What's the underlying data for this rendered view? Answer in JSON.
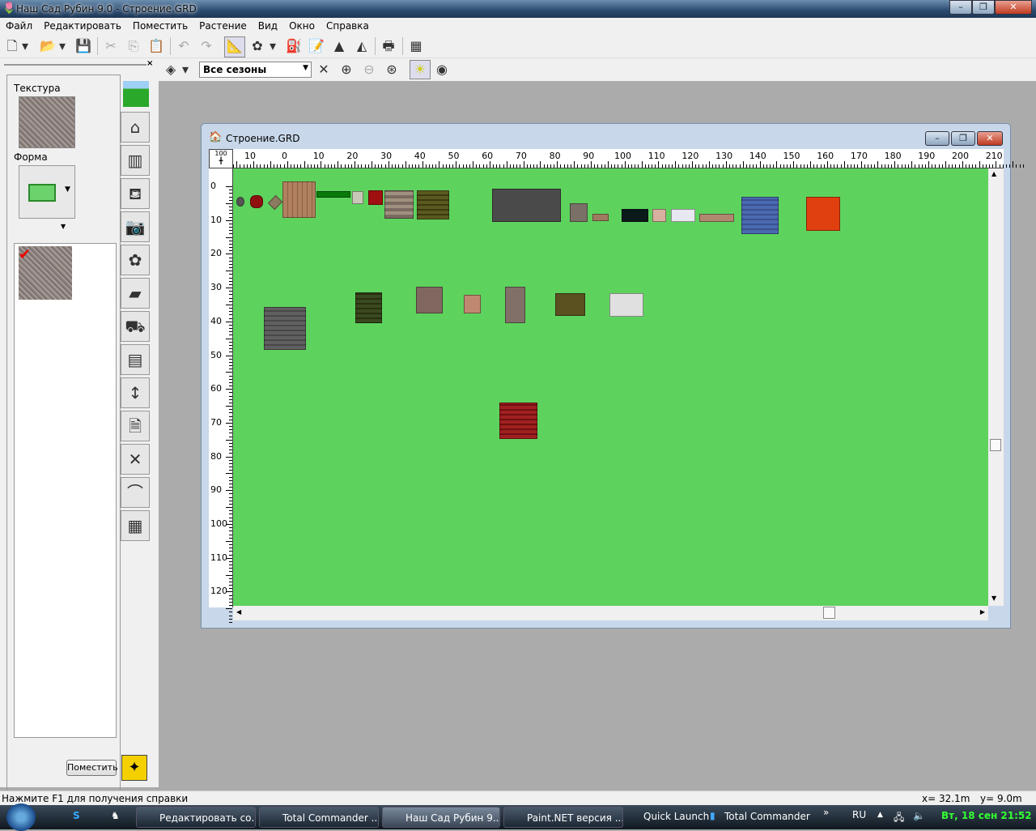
{
  "window": {
    "title": "Наш Сад Рубин 9.0 - Строение.GRD"
  },
  "menu": [
    "Файл",
    "Редактировать",
    "Поместить",
    "Растение",
    "Вид",
    "Окно",
    "Справка"
  ],
  "toolbar2": {
    "season": "Все сезоны"
  },
  "left_panel": {
    "texture_label": "Текстура",
    "shape_label": "Форма",
    "place_button": "Поместить"
  },
  "document": {
    "title": "Строение.GRD",
    "ruler_top": [
      "10",
      "0",
      "10",
      "20",
      "30",
      "40",
      "50",
      "60",
      "70",
      "80",
      "90",
      "100",
      "110",
      "120",
      "130",
      "140",
      "150",
      "160",
      "170",
      "180",
      "190",
      "200",
      "210"
    ],
    "ruler_left": [
      "0",
      "10",
      "20",
      "30",
      "40",
      "50",
      "60",
      "70",
      "80",
      "90",
      "100",
      "110",
      "120"
    ],
    "canvas_color": "#5dd35d"
  },
  "status": {
    "help": "Нажмите F1 для получения справки",
    "x": "x=  32.1m",
    "y": "y=   9.0m"
  },
  "taskbar": {
    "tasks": [
      "Редактировать со...",
      "Total Commander ...",
      "Наш Сад Рубин 9....",
      "Paint.NET версия ..."
    ],
    "quick_launch": "Quick Launch",
    "tc": "Total Commander",
    "lang": "RU",
    "clock": "Вт, 18 сен 21:52"
  }
}
